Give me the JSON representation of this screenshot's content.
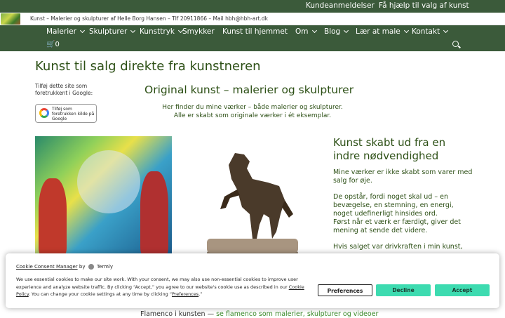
{
  "topbar": {
    "reviews": "Kundeanmeldelser",
    "help": "Få hjælp til valg af kunst"
  },
  "infobar": {
    "text": "Kunst – Malerier og skulpturer af Helle Borg Hansen – Tlf 20911866 – Mail hbh@hbh-art.dk"
  },
  "nav": {
    "items": [
      "Malerier",
      "Skulpturer",
      "Kunsttryk",
      "Smykker",
      "Kunst til hjemmet",
      "Om",
      "Blog",
      "Lær at male",
      "Kontakt"
    ],
    "cart": "0"
  },
  "main": {
    "title": "Kunst til salg direkte fra kunstneren",
    "google_text": "Tilføj dette site som foretrukkent i Google:",
    "google_badge": "Tilføj som foretrukken kilde på Google",
    "subtitle": "Original kunst – malerier og skulpturer",
    "desc1": "Her finder du mine værker – både malerier og skulpturer.",
    "desc2": "Alle er skabt som originale værker i ét eksemplar.",
    "side_title": "Kunst skabt ud fra en indre nødvendighed",
    "side_p1": "Mine værker er ikke skabt som varer med salg for øje.",
    "side_p2": "De opstår, fordi noget skal ud – en bevægelse, en stemning, en energi, noget udefinerligt hinsides ord.",
    "side_p3": "Først når et værk er færdigt, giver det mening at sende det videre.",
    "side_p4": "Hvis salget var drivkraften i min kunst,",
    "footer_text": "Flamenco i kunsten —",
    "footer_link": "se flamenco som malerier, skulpturer og videoer"
  },
  "cookie": {
    "manager": "Cookie Consent Manager",
    "by": "by",
    "termly": "Termly",
    "body1": "We use essential cookies to make our site work. With your consent, we may also use non-essential cookies to improve user experience and analyze website traffic. By clicking “Accept,” you agree to our website's cookie use as described in our",
    "policy": "Cookie Policy",
    "body2": ". You can change your cookie settings at any time by clicking “",
    "prefs_link": "Preferences",
    "body3": ".”",
    "btn_preferences": "Preferences",
    "btn_decline": "Decline",
    "btn_accept": "Accept"
  }
}
